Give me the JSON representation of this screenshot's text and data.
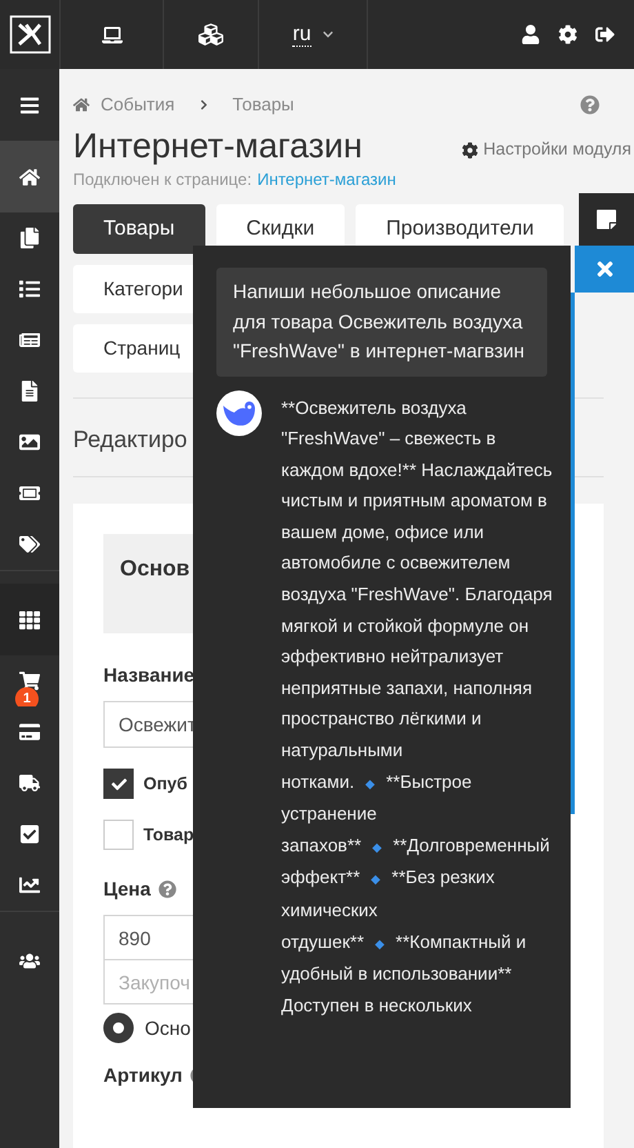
{
  "topbar": {
    "language": "ru"
  },
  "sidebar": {
    "items": [
      {
        "kind": "menu",
        "selected": false
      },
      {
        "kind": "home",
        "selected": true
      },
      {
        "kind": "copy",
        "selected": false
      },
      {
        "kind": "list",
        "selected": false
      },
      {
        "kind": "news",
        "selected": false
      },
      {
        "kind": "file",
        "selected": false
      },
      {
        "kind": "image",
        "selected": false
      },
      {
        "kind": "ticket",
        "selected": false
      },
      {
        "kind": "tags",
        "selected": false
      },
      {
        "kind": "grid",
        "selected": false
      },
      {
        "kind": "cart",
        "selected": false,
        "badge": "1"
      },
      {
        "kind": "card",
        "selected": false
      },
      {
        "kind": "truck",
        "selected": false
      },
      {
        "kind": "check",
        "selected": false
      },
      {
        "kind": "chart",
        "selected": false
      },
      {
        "kind": "users",
        "selected": false
      }
    ]
  },
  "breadcrumb": [
    "События",
    "Товары"
  ],
  "title": "Интернет-магазин",
  "subtitle": {
    "label": "Подключен к странице:",
    "link": "Интернет-магазин"
  },
  "settings_link": "Настройки модуля",
  "tabs": [
    {
      "label": "Товары",
      "selected": true
    },
    {
      "label": "Скидки",
      "selected": false
    },
    {
      "label": "Производители",
      "selected": false
    }
  ],
  "subtabs": [
    "Категори",
    "Страниц"
  ],
  "section_title": "Редактиро",
  "card_header": "Основ",
  "form": {
    "name_label": "Название",
    "name_value": "Освежит",
    "checkboxes": [
      {
        "label": "Опуб",
        "checked": true
      },
      {
        "label": "Товар",
        "checked": false
      }
    ],
    "price_label": "Цена",
    "price_value": "890",
    "purchase_placeholder": "Закупоч",
    "radio": {
      "label": "Осно",
      "selected": true
    },
    "article_label": "Артикул"
  },
  "chat": {
    "prompt": "Напиши небольшое описание для товара Освежитель воздуха \"FreshWave\" в интернет-магвзин",
    "answer_parts": [
      {
        "kind": "text",
        "text": "**Освежитель воздуха \"FreshWave\" – свежесть в каждом вдохе!** Наслаждайтесь чистым и приятным ароматом в вашем доме, офисе или автомобиле с освежителем воздуха \"FreshWave\". Благодаря мягкой и стойкой формуле он эффективно нейтрализует неприятные запахи, наполняя пространство лёгкими и натуральными нотками."
      },
      {
        "kind": "bullet",
        "text": "◆"
      },
      {
        "kind": "text",
        "text": "**Быстрое устранение запахов**"
      },
      {
        "kind": "bullet",
        "text": "◆"
      },
      {
        "kind": "text",
        "text": "**Долговременный эффект**"
      },
      {
        "kind": "bullet",
        "text": "◆"
      },
      {
        "kind": "text",
        "text": "**Без резких химических отдушек**"
      },
      {
        "kind": "bullet",
        "text": "◆"
      },
      {
        "kind": "text",
        "text": "**Компактный и удобный в использовании** Доступен в нескольких"
      }
    ]
  }
}
